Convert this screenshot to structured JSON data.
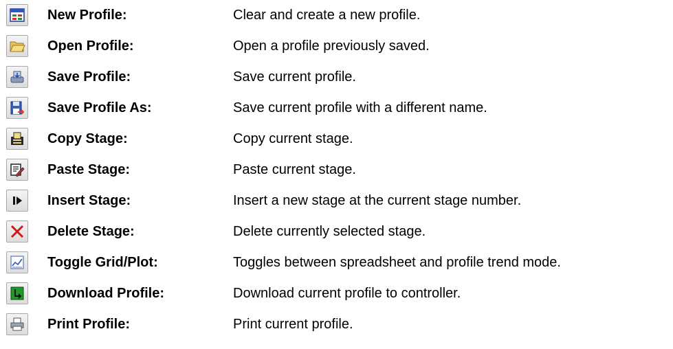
{
  "commands": [
    {
      "icon": "new-profile-icon",
      "name": "New Profile:",
      "description": "Clear and create a new profile."
    },
    {
      "icon": "open-folder-icon",
      "name": "Open Profile:",
      "description": "Open a profile previously saved."
    },
    {
      "icon": "save-profile-icon",
      "name": "Save Profile:",
      "description": "Save current profile."
    },
    {
      "icon": "save-as-icon",
      "name": "Save Profile As:",
      "description": "Save current profile with a different name."
    },
    {
      "icon": "copy-stage-icon",
      "name": "Copy Stage:",
      "description": "Copy current stage."
    },
    {
      "icon": "paste-stage-icon",
      "name": "Paste Stage:",
      "description": "Paste current stage."
    },
    {
      "icon": "insert-stage-icon",
      "name": "Insert Stage:",
      "description": "Insert a new stage at the current stage number."
    },
    {
      "icon": "delete-x-icon",
      "name": "Delete Stage:",
      "description": "Delete currently selected stage."
    },
    {
      "icon": "trend-plot-icon",
      "name": "Toggle Grid/Plot:",
      "description": "Toggles between spreadsheet and profile trend mode."
    },
    {
      "icon": "download-icon",
      "name": "Download Profile:",
      "description": "Download current profile to controller."
    },
    {
      "icon": "printer-icon",
      "name": "Print Profile:",
      "description": "Print current profile."
    }
  ],
  "colors": {
    "delete": "#d01818",
    "download": "#1f9a2a",
    "button_border": "#a8a8a8"
  }
}
